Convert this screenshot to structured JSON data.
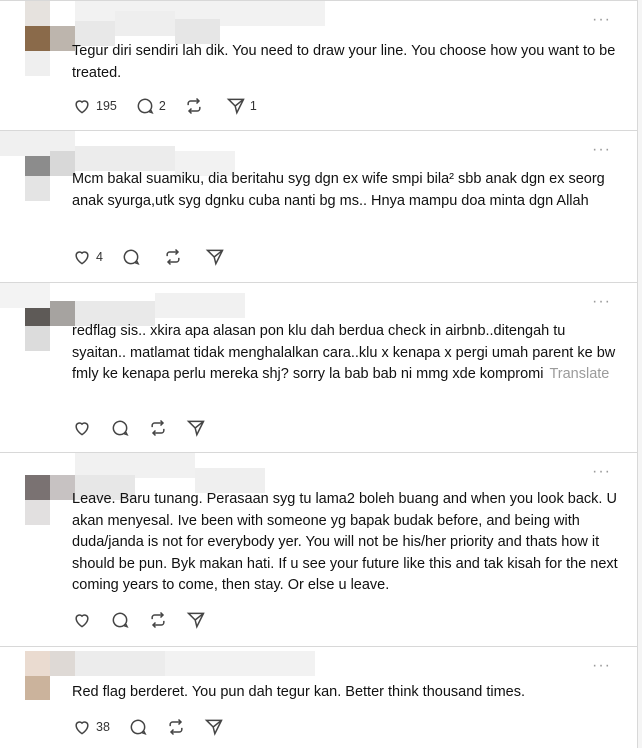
{
  "more_glyph": "···",
  "translate_label": "Translate",
  "posts": [
    {
      "text": "Tegur diri sendiri lah dik. You need to draw your line. You choose how you want to be treated.",
      "likes": "195",
      "replies": "2",
      "reposts": "",
      "shares": "1"
    },
    {
      "text": "Mcm bakal suamiku, dia beritahu syg dgn ex wife smpi bila² sbb anak dgn ex seorg anak syurga,utk syg dgnku cuba nanti bg ms.. Hnya mampu doa minta dgn Allah",
      "likes": "4",
      "replies": "",
      "reposts": "",
      "shares": ""
    },
    {
      "text": "redflag sis.. xkira apa alasan pon klu dah berdua check in airbnb..ditengah tu syaitan.. matlamat tidak menghalalkan cara..klu x kenapa x pergi umah parent ke bw fmly ke kenapa perlu mereka shj? sorry la bab bab ni mmg xde kompromi",
      "likes": "",
      "replies": "",
      "reposts": "",
      "shares": ""
    },
    {
      "text": "Leave. Baru tunang. Perasaan syg tu lama2 boleh buang and when you look back. U akan menyesal. Ive been with someone yg bapak budak before, and being with duda/janda is not for everybody yer. You will not be his/her priority and thats how it should be pun. Byk makan hati. If u see your future like this and tak kisah for the next coming years to come, then stay. Or else u leave.",
      "likes": "",
      "replies": "",
      "reposts": "",
      "shares": ""
    },
    {
      "text": "Red flag berderet. You pun dah tegur kan. Better think thousand times.",
      "likes": "38",
      "replies": "",
      "reposts": "",
      "shares": ""
    }
  ],
  "avatar_colors": [
    "#8a6a4a",
    "#8c8c8c",
    "#5e5a57",
    "#7a7272",
    "#cbb39c"
  ],
  "icons": [
    "heart-icon",
    "comment-icon",
    "repost-icon",
    "share-icon",
    "more-icon"
  ]
}
